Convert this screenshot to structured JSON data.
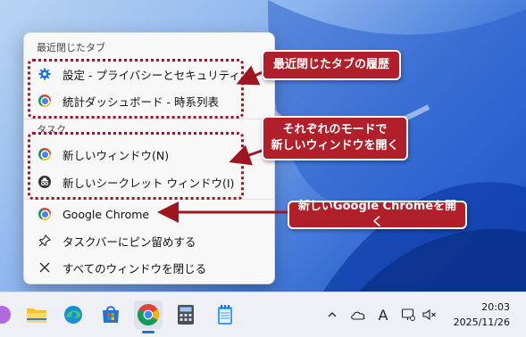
{
  "menu": {
    "recent_section": "最近閉じたタブ",
    "recent_items": [
      {
        "label": "設定 - プライバシーとセキュリティ",
        "icon": "gear-icon"
      },
      {
        "label": "統計ダッシュボード - 時系列表",
        "icon": "chrome-icon"
      }
    ],
    "tasks_section": "タスク",
    "task_items": [
      {
        "label": "新しいウィンドウ(N)",
        "icon": "chrome-icon"
      },
      {
        "label": "新しいシークレット ウィンドウ(I)",
        "icon": "incognito-icon"
      }
    ],
    "app_items": [
      {
        "label": "Google Chrome",
        "icon": "chrome-icon"
      },
      {
        "label": "タスクバーにピン留めする",
        "icon": "pin-icon"
      },
      {
        "label": "すべてのウィンドウを閉じる",
        "icon": "close-icon"
      }
    ]
  },
  "callouts": {
    "recent": "最近閉じたタブの履歴",
    "modes_line1": "それぞれのモードで",
    "modes_line2": "新しいウィンドウを開く",
    "chrome": "新しいGoogle Chromeを開く"
  },
  "colors": {
    "callout": "#b01f2a",
    "accent": "#1a73e8"
  },
  "taskbar": {
    "apps": [
      "file-explorer-icon",
      "edge-icon",
      "store-icon",
      "chrome-icon",
      "calculator-icon",
      "notepad-icon"
    ],
    "tray": [
      "chevron-up-icon",
      "cloud-icon",
      "ime-icon",
      "display-icon",
      "volume-mute-icon"
    ],
    "ime_label": "A",
    "time": "20:03",
    "date": "2025/11/26"
  }
}
